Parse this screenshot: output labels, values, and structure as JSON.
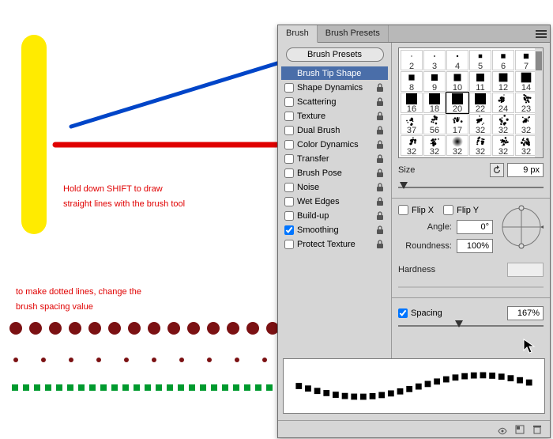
{
  "annotations": {
    "tip1_line1": "Hold down  SHIFT to draw",
    "tip1_line2": "straight lines with the brush tool",
    "tip2_line1": "to make dotted lines, change the",
    "tip2_line2": "brush spacing value"
  },
  "panel": {
    "tabs": [
      "Brush",
      "Brush Presets"
    ],
    "activeTab": 0,
    "topButton": "Brush Presets",
    "options": [
      {
        "label": "Brush Tip Shape",
        "toggle": false,
        "checked": false,
        "selected": true,
        "lock": false
      },
      {
        "label": "Shape Dynamics",
        "toggle": true,
        "checked": false,
        "selected": false,
        "lock": true
      },
      {
        "label": "Scattering",
        "toggle": true,
        "checked": false,
        "selected": false,
        "lock": true
      },
      {
        "label": "Texture",
        "toggle": true,
        "checked": false,
        "selected": false,
        "lock": true
      },
      {
        "label": "Dual Brush",
        "toggle": true,
        "checked": false,
        "selected": false,
        "lock": true
      },
      {
        "label": "Color Dynamics",
        "toggle": true,
        "checked": false,
        "selected": false,
        "lock": true
      },
      {
        "label": "Transfer",
        "toggle": true,
        "checked": false,
        "selected": false,
        "lock": true
      },
      {
        "label": "Brush Pose",
        "toggle": true,
        "checked": false,
        "selected": false,
        "lock": true
      },
      {
        "label": "Noise",
        "toggle": true,
        "checked": false,
        "selected": false,
        "lock": true
      },
      {
        "label": "Wet Edges",
        "toggle": true,
        "checked": false,
        "selected": false,
        "lock": true
      },
      {
        "label": "Build-up",
        "toggle": true,
        "checked": false,
        "selected": false,
        "lock": true
      },
      {
        "label": "Smoothing",
        "toggle": true,
        "checked": true,
        "selected": false,
        "lock": true
      },
      {
        "label": "Protect Texture",
        "toggle": true,
        "checked": false,
        "selected": false,
        "lock": true
      }
    ],
    "thumbs": [
      {
        "size": 2,
        "kind": "dot",
        "sel": false
      },
      {
        "size": 3,
        "kind": "dot",
        "sel": false
      },
      {
        "size": 4,
        "kind": "dot",
        "sel": false
      },
      {
        "size": 5,
        "kind": "sq",
        "sel": false
      },
      {
        "size": 6,
        "kind": "sq",
        "sel": false
      },
      {
        "size": 7,
        "kind": "sq",
        "sel": false
      },
      {
        "size": 8,
        "kind": "sq",
        "sel": false
      },
      {
        "size": 9,
        "kind": "sq",
        "sel": false
      },
      {
        "size": 10,
        "kind": "sq",
        "sel": false
      },
      {
        "size": 11,
        "kind": "sq",
        "sel": false
      },
      {
        "size": 12,
        "kind": "sq",
        "sel": false
      },
      {
        "size": 14,
        "kind": "sq",
        "sel": false
      },
      {
        "size": 16,
        "kind": "sq",
        "sel": false
      },
      {
        "size": 18,
        "kind": "sq",
        "sel": false
      },
      {
        "size": 20,
        "kind": "sq",
        "sel": true
      },
      {
        "size": 22,
        "kind": "sq",
        "sel": false
      },
      {
        "size": 24,
        "kind": "spatter",
        "sel": false
      },
      {
        "size": 23,
        "kind": "spatter",
        "sel": false
      },
      {
        "size": 37,
        "kind": "spatter",
        "sel": false
      },
      {
        "size": 56,
        "kind": "spatter",
        "sel": false
      },
      {
        "size": 17,
        "kind": "spatter",
        "sel": false
      },
      {
        "size": 32,
        "kind": "spatter",
        "sel": false
      },
      {
        "size": 32,
        "kind": "spatter",
        "sel": false
      },
      {
        "size": 32,
        "kind": "spatter",
        "sel": false
      },
      {
        "size": 32,
        "kind": "spatter",
        "sel": false
      },
      {
        "size": 32,
        "kind": "spatter",
        "sel": false
      },
      {
        "size": 32,
        "kind": "radial",
        "sel": false
      },
      {
        "size": 32,
        "kind": "spatter",
        "sel": false
      },
      {
        "size": 32,
        "kind": "spatter",
        "sel": false
      },
      {
        "size": 32,
        "kind": "spatter",
        "sel": false
      }
    ],
    "sizeLabel": "Size",
    "sizeValue": "9 px",
    "sizeKnobPct": 4,
    "flipX": {
      "label": "Flip X",
      "checked": false
    },
    "flipY": {
      "label": "Flip Y",
      "checked": false
    },
    "angleLabel": "Angle:",
    "angleValue": "0°",
    "roundnessLabel": "Roundness:",
    "roundnessValue": "100%",
    "hardnessLabel": "Hardness",
    "spacingLabel": "Spacing",
    "spacingChecked": true,
    "spacingValue": "167%",
    "spacingKnobPct": 42
  },
  "colors": {
    "yellow": "#FFEB00",
    "blue": "#0045C8",
    "red": "#E00000",
    "darkred": "#7B1113",
    "green": "#009A2E"
  }
}
